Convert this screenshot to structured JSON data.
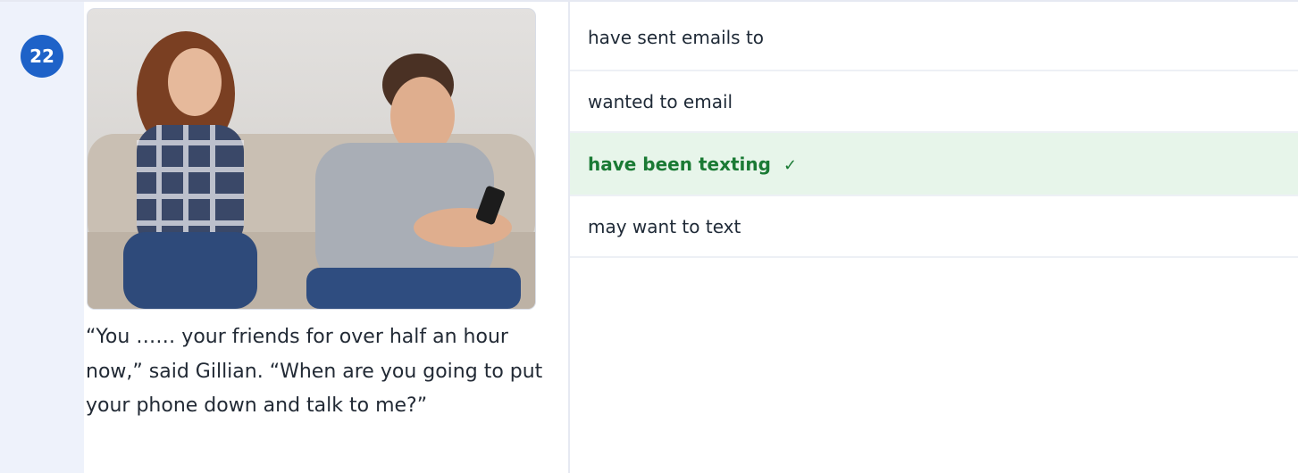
{
  "question": {
    "number": "22",
    "prompt": "“You …… your friends for over half an hour now,” said Gillian. “When are you going to put your phone down and talk to me?”",
    "image_alt": "woman looking annoyed at man texting on phone on a couch"
  },
  "options": [
    {
      "label": "have sent emails to",
      "correct": false
    },
    {
      "label": "wanted to email",
      "correct": false
    },
    {
      "label": "have been texting",
      "correct": true,
      "mark": "✓"
    },
    {
      "label": "may want to text",
      "correct": false
    }
  ],
  "colors": {
    "accent": "#1e62c8",
    "correct_bg": "#e7f5ea",
    "correct_text": "#1a7a34"
  }
}
